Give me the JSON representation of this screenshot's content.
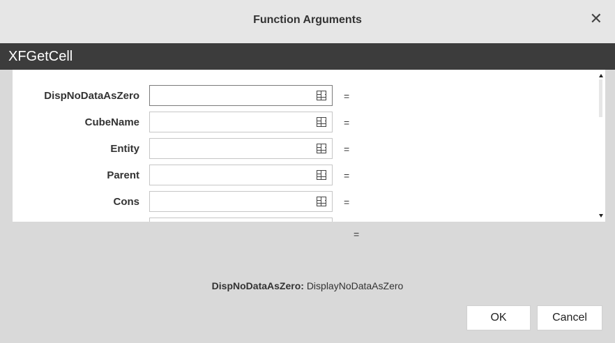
{
  "dialog": {
    "title": "Function Arguments",
    "close_glyph": "✕"
  },
  "function": {
    "name": "XFGetCell"
  },
  "arguments": [
    {
      "label": "DispNoDataAsZero",
      "value": "",
      "equals": "="
    },
    {
      "label": "CubeName",
      "value": "",
      "equals": "="
    },
    {
      "label": "Entity",
      "value": "",
      "equals": "="
    },
    {
      "label": "Parent",
      "value": "",
      "equals": "="
    },
    {
      "label": "Cons",
      "value": "",
      "equals": "="
    }
  ],
  "result": {
    "equals": "="
  },
  "description": {
    "arg_name": "DispNoDataAsZero:",
    "text": "DisplayNoDataAsZero"
  },
  "buttons": {
    "ok": "OK",
    "cancel": "Cancel"
  },
  "colors": {
    "header_bg": "#3c3c3c",
    "dialog_bg": "#d9d9d9",
    "titlebar_bg": "#e6e6e6"
  },
  "icons": {
    "ref": "range-select-icon"
  }
}
